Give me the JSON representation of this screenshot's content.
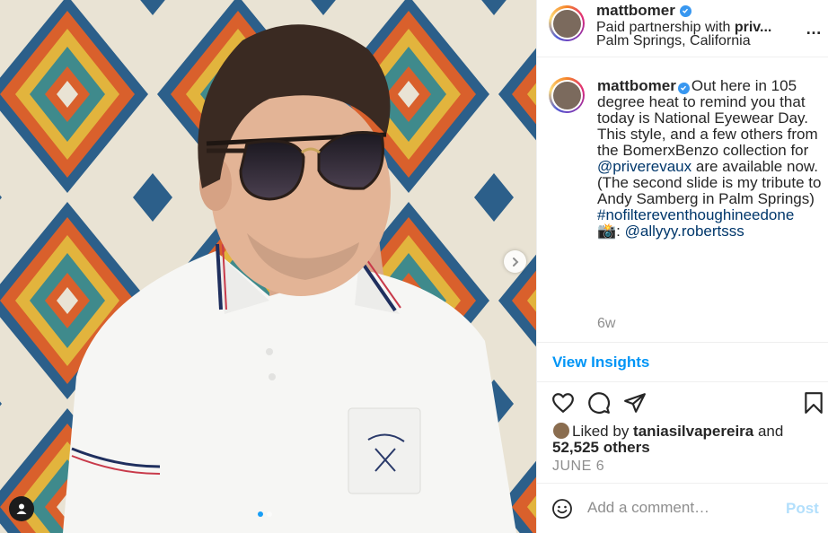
{
  "post": {
    "username": "mattbomer",
    "partnership_prefix": "Paid partnership with ",
    "partner_short": "priv...",
    "location": "Palm Springs, California",
    "more_label": "…",
    "caption": {
      "text_1": "Out here in 105 degree heat to remind you that today is National Eyewear Day. This style, and a few others from the BomerxBenzo collection for ",
      "mention_1": "@priverevaux",
      "text_2": " are available now.",
      "text_3": "(The second slide is my tribute to Andy Samberg in Palm Springs)",
      "hashtag": "#nofiltereventhoughineedone",
      "camera_emoji": "📸",
      "text_4": ": ",
      "mention_2": "@allyyy.robertsss"
    },
    "caption_time": "6w",
    "view_insights": "View Insights",
    "likes": {
      "prefix": "Liked by ",
      "liker": "taniasilvapereira",
      "middle": " and",
      "count": "52,525 others"
    },
    "date": "JUNE 6",
    "comment": {
      "placeholder": "Add a comment…",
      "post_label": "Post"
    }
  },
  "carousel": {
    "slides": 2,
    "active_slide": 1
  },
  "colors": {
    "link": "#00376b",
    "accent": "#0095f6",
    "verified": "#3897f0",
    "muted": "#8e8e8e",
    "post_disabled": "#b2dffc"
  },
  "icons": [
    "verified-badge-icon",
    "more-options-icon",
    "heart-icon",
    "comment-icon",
    "share-icon",
    "bookmark-icon",
    "emoji-icon",
    "chevron-right-icon",
    "user-tag-icon"
  ]
}
